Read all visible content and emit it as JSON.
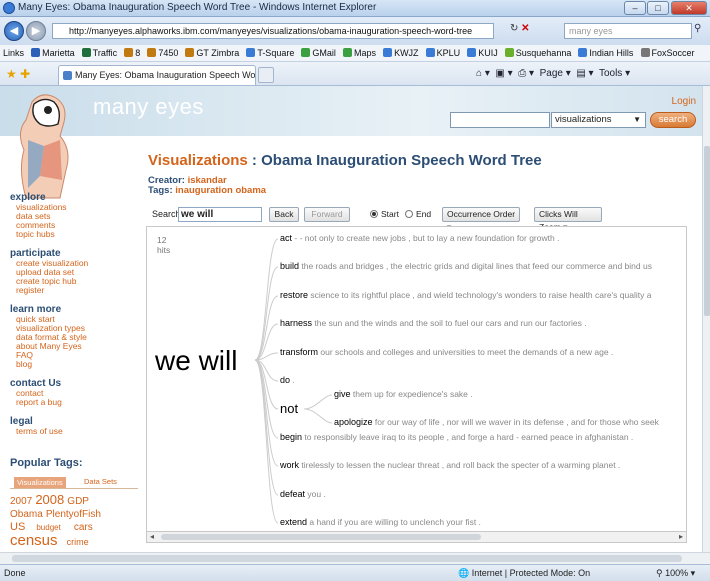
{
  "window": {
    "title": "Many Eyes: Obama Inauguration Speech Word Tree - Windows Internet Explorer",
    "controls": [
      "–",
      "□",
      "✕"
    ]
  },
  "address_bar": {
    "url": "http://manyeyes.alphaworks.ibm.com/manyeyes/visualizations/obama-inauguration-speech-word-tree",
    "search_placeholder": "many eyes",
    "refresh": "↻",
    "stop": "✕"
  },
  "links_bar": {
    "label": "Links",
    "items": [
      "Marietta",
      "Traffic",
      "8",
      "7450",
      "GT Zimbra",
      "T-Square",
      "GMail",
      "Maps",
      "KWJZ",
      "KPLU",
      "KUIJ",
      "Susquehanna",
      "Indian Hills",
      "FoxSoccer"
    ]
  },
  "tab": {
    "label": "Many Eyes: Obama Inauguration Speech Word Tr...",
    "commands": [
      "Page ▾",
      "Tools ▾"
    ]
  },
  "site": {
    "brand": "many eyes",
    "login": "Login",
    "search_select": "visualizations",
    "search_button": "search"
  },
  "page": {
    "title_prefix": "Visualizations",
    "title_sep": " : ",
    "title": "Obama Inauguration Speech Word Tree",
    "creator_label": "Creator: ",
    "creator": "iskandar",
    "tags_label": "Tags: ",
    "tags": "inauguration obama"
  },
  "sidebar": {
    "sections": [
      {
        "heading": "explore",
        "links": [
          "visualizations",
          "data sets",
          "comments",
          "topic hubs"
        ]
      },
      {
        "heading": "participate",
        "links": [
          "create visualization",
          "upload data set",
          "create topic hub",
          "register"
        ]
      },
      {
        "heading": "learn more",
        "links": [
          "quick start",
          "visualization types",
          "data format & style",
          "about Many Eyes",
          "FAQ",
          "blog"
        ]
      },
      {
        "heading": "contact Us",
        "links": [
          "contact",
          "report a bug"
        ]
      },
      {
        "heading": "legal",
        "links": [
          "terms of use"
        ]
      }
    ],
    "popular_tags": {
      "heading": "Popular Tags:",
      "tabs": [
        "Visualizations",
        "Data Sets"
      ],
      "tags": [
        "2007",
        "2008",
        "GDP",
        "Obama",
        "PlentyofFish",
        "US",
        "budget",
        "cars",
        "census",
        "crime"
      ]
    }
  },
  "controls": {
    "search_label": "Search",
    "search_value": "we will",
    "back": "Back",
    "forward": "Forward",
    "start": "Start",
    "end": "End",
    "order": "Occurrence Order",
    "zoom": "Clicks Will Zoom"
  },
  "wordtree": {
    "hits_count": "12",
    "hits_label": "hits",
    "root": "we will",
    "branches": [
      {
        "word": "act",
        "rest": " - - not only to create new jobs , but to lay a new foundation for growth ."
      },
      {
        "word": "build",
        "rest": " the roads and bridges , the electric grids and digital lines that feed our commerce and bind us"
      },
      {
        "word": "restore",
        "rest": " science to its rightful place , and wield technology's wonders to raise health care's quality a"
      },
      {
        "word": "harness",
        "rest": " the sun and the winds and the soil to fuel our cars and run our factories ."
      },
      {
        "word": "transform",
        "rest": " our schools and colleges and universities to meet the demands of a new age ."
      },
      {
        "word": "do",
        "rest": " ."
      },
      {
        "word": "not",
        "rest": "",
        "children": [
          {
            "word": "give",
            "rest": " them up for expedience's sake ."
          },
          {
            "word": "apologize",
            "rest": " for our way of life , nor will we waver in its defense , and for those who seek"
          }
        ]
      },
      {
        "word": "begin",
        "rest": " to responsibly leave iraq to its people , and forge a hard - earned peace in afghanistan ."
      },
      {
        "word": "work",
        "rest": " tirelessly to lessen the nuclear threat , and roll back the specter of a warming planet ."
      },
      {
        "word": "defeat",
        "rest": " you ."
      },
      {
        "word": "extend",
        "rest": " a hand if you are willing to unclench your fist ."
      }
    ]
  },
  "status": {
    "left": "Done",
    "zone": "Internet | Protected Mode: On",
    "zoom": "100%"
  }
}
